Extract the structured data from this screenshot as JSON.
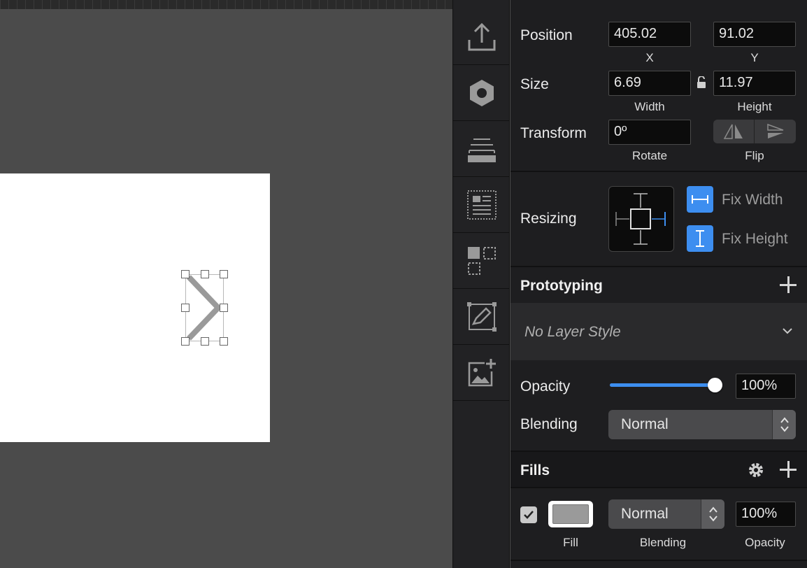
{
  "toolbar": {
    "tools": [
      {
        "name": "export-icon"
      },
      {
        "name": "symbol-icon"
      },
      {
        "name": "layer-stack-icon"
      },
      {
        "name": "text-layout-icon"
      },
      {
        "name": "components-icon"
      },
      {
        "name": "edit-shape-icon"
      },
      {
        "name": "add-image-icon"
      }
    ]
  },
  "geometry_section": {
    "position_label": "Position",
    "x_value": "405.02",
    "x_label": "X",
    "y_value": "91.02",
    "y_label": "Y",
    "size_label": "Size",
    "width_value": "6.69",
    "width_label": "Width",
    "height_value": "11.97",
    "height_label": "Height",
    "transform_label": "Transform",
    "rotate_value": "0º",
    "rotate_label": "Rotate",
    "flip_label": "Flip"
  },
  "resizing": {
    "label": "Resizing",
    "fix_width_label": "Fix Width",
    "fix_height_label": "Fix Height"
  },
  "prototyping": {
    "title": "Prototyping"
  },
  "layer_style": {
    "value": "No Layer Style"
  },
  "appearance": {
    "opacity_label": "Opacity",
    "opacity_value": "100%",
    "opacity_level": 1.0,
    "blending_label": "Blending",
    "blending_value": "Normal"
  },
  "fills": {
    "title": "Fills",
    "checked": true,
    "swatch_color": "#9a9a9a",
    "blend_value": "Normal",
    "opacity_value": "100%",
    "fill_label": "Fill",
    "blending_label": "Blending",
    "opacity_label": "Opacity"
  },
  "colors": {
    "accent": "#3d8ef0",
    "panel_bg": "#1e1e20",
    "canvas_bg": "#4b4b4b",
    "artboard": "#ffffff",
    "chevron": "#9a9a9a"
  }
}
